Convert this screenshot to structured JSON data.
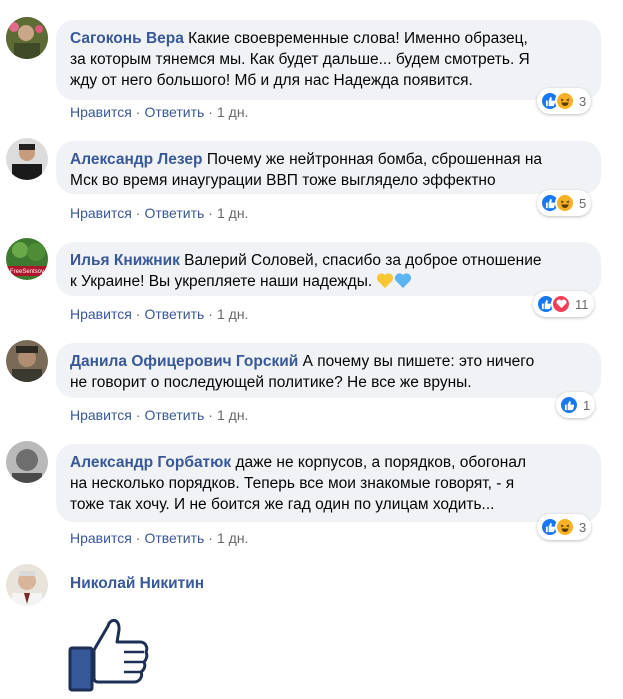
{
  "actions": {
    "like": "Нравится",
    "reply": "Ответить",
    "separator": "·",
    "time": "1 дн."
  },
  "comments": [
    {
      "author": "Сагоконь Вера",
      "lines": [
        "Какие своевременные слова! Именно образец,",
        "за которым тянемся мы. Как будет дальше... будем смотреть. Я",
        "жду от него большого! Мб и для нас Надежда появится."
      ],
      "reactions": [
        "like",
        "haha"
      ],
      "count": "3"
    },
    {
      "author": "Александр Лезер",
      "lines": [
        "Почему же нейтронная бомба, сброшенная на",
        "Мск во время инаугурации ВВП тоже выглядело эффектно"
      ],
      "reactions": [
        "like",
        "haha"
      ],
      "count": "5"
    },
    {
      "author": "Илья Книжник",
      "lines": [
        "Валерий Соловей, спасибо за доброе отношение",
        "к Украине! Вы укрепляете наши надежды."
      ],
      "reactions": [
        "like",
        "love"
      ],
      "count": "11"
    },
    {
      "author": "Данила Офицерович Горский",
      "lines": [
        "А почему вы пишете: это ничего",
        "не говорит о последующей политике? Не все же вруны."
      ],
      "reactions": [
        "like"
      ],
      "count": "1"
    },
    {
      "author": "Александр Горбатюк",
      "lines": [
        "даже не корпусов, а порядков, обогонал",
        "на несколько порядков. Теперь все мои знакомые говорят, - я",
        "тоже так хочу. И не боится же гад один по улицам ходить..."
      ],
      "reactions": [
        "like",
        "haha"
      ],
      "count": "3"
    }
  ],
  "last_comment": {
    "author": "Николай Никитин",
    "sticker": "thumbs-up"
  },
  "colors": {
    "author": "#385898",
    "bubble": "#f0f2f5",
    "like": "#1877f2",
    "haha": "#f7b125",
    "love": "#f33e58"
  }
}
